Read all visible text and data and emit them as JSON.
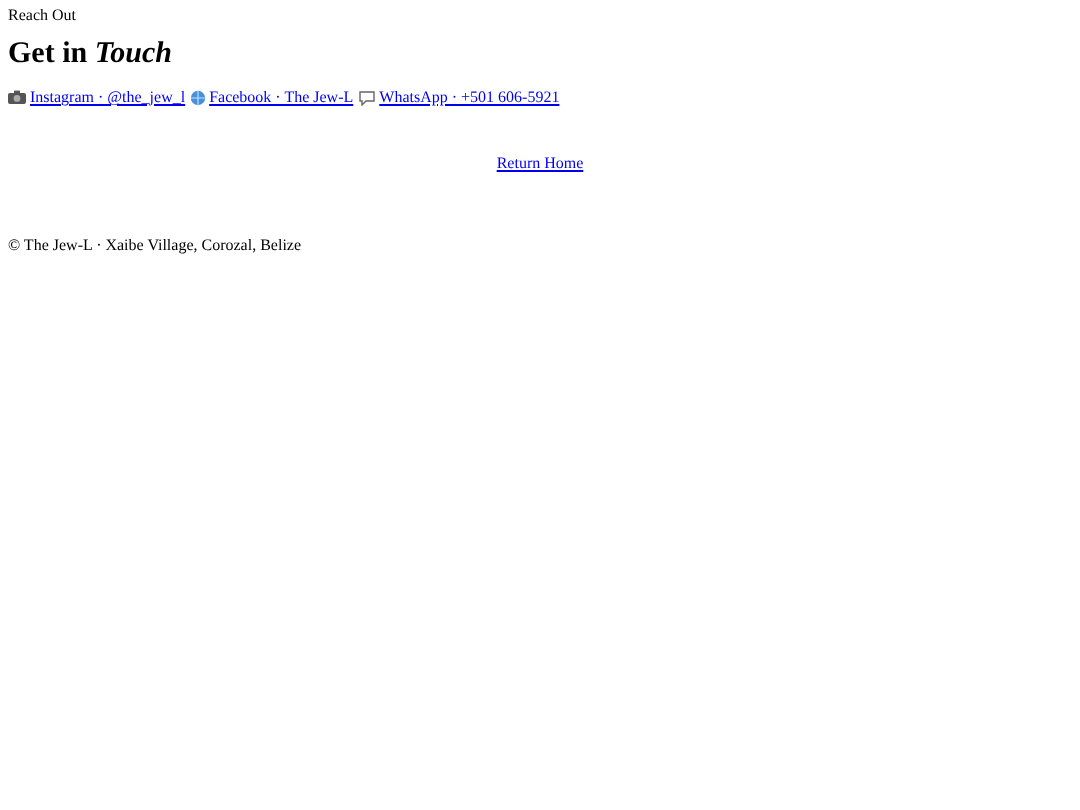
{
  "eyebrow": "Reach Out",
  "heading": "Get in *Touch*",
  "links": [
    {
      "kind": "camera",
      "label": "Instagram · @the_jew_l"
    },
    {
      "kind": "globe",
      "label": "Facebook · The Jew-L"
    },
    {
      "kind": "speech",
      "label": "WhatsApp · +501 606-5921"
    }
  ],
  "return_link": "Return Home",
  "footer": "© The Jew-L · Xaibe Village, Corozal, Belize"
}
